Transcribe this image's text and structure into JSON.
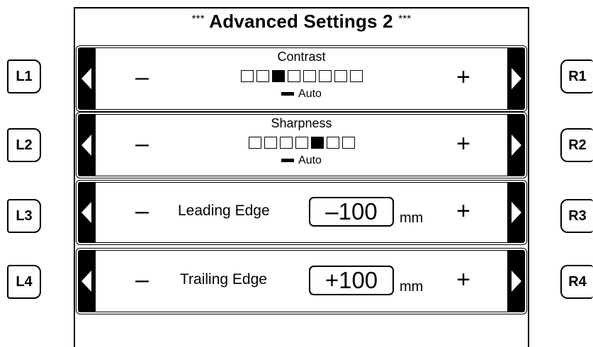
{
  "title": {
    "stars_left": "***",
    "text": "Advanced Settings 2",
    "stars_right": "***"
  },
  "left_buttons": [
    "L1",
    "L2",
    "L3",
    "L4"
  ],
  "right_buttons": [
    "R1",
    "R2",
    "R3",
    "R4"
  ],
  "controls": {
    "minus": "–",
    "plus": "+"
  },
  "contrast": {
    "label": "Contrast",
    "level": 3,
    "steps": 8,
    "auto_label": "Auto"
  },
  "sharpness": {
    "label": "Sharpness",
    "level": 5,
    "steps": 7,
    "auto_label": "Auto"
  },
  "leading_edge": {
    "label": "Leading Edge",
    "value": "–100",
    "unit": "mm"
  },
  "trailing_edge": {
    "label": "Trailing Edge",
    "value": "+100",
    "unit": "mm"
  },
  "icons": {
    "left_arrow": "left-arrow-icon",
    "right_arrow": "right-arrow-icon"
  }
}
